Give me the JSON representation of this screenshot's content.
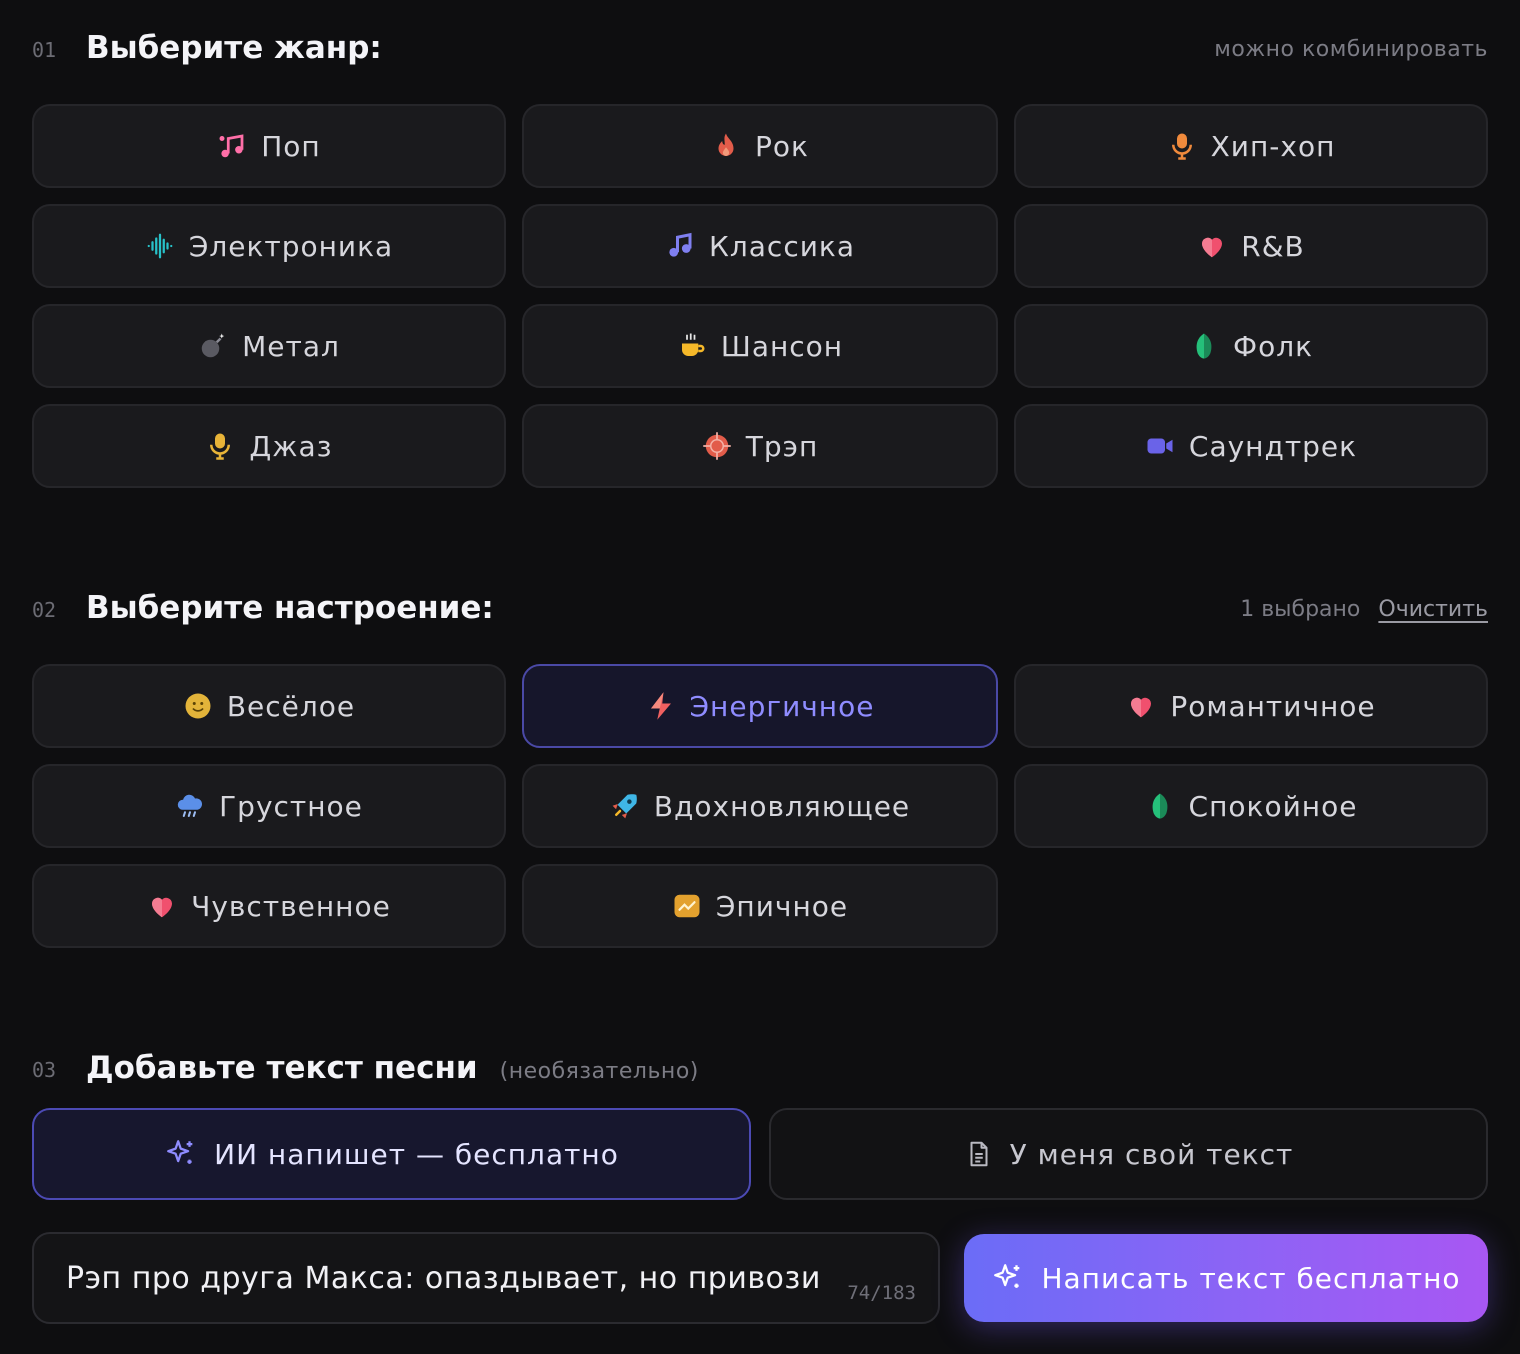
{
  "genre": {
    "num": "01",
    "title": "Выберите жанр:",
    "hint": "можно комбинировать",
    "options": [
      {
        "label": "Поп",
        "icon": "music-notes-icon",
        "color": "#ff6fa8"
      },
      {
        "label": "Рок",
        "icon": "flame-icon",
        "color": "#e25c4a"
      },
      {
        "label": "Хип-хоп",
        "icon": "microphone-icon",
        "color": "#f08a3c"
      },
      {
        "label": "Электроника",
        "icon": "sound-wave-icon",
        "color": "#28c2c9"
      },
      {
        "label": "Классика",
        "icon": "music-note-icon",
        "color": "#7f7ff0"
      },
      {
        "label": "R&B",
        "icon": "heart-icon",
        "color": "#f0506e"
      },
      {
        "label": "Метал",
        "icon": "bomb-icon",
        "color": "#8a8a94"
      },
      {
        "label": "Шансон",
        "icon": "coffee-cup-icon",
        "color": "#f5b829"
      },
      {
        "label": "Фолк",
        "icon": "leaf-icon",
        "color": "#25c07a"
      },
      {
        "label": "Джаз",
        "icon": "microphone-icon",
        "color": "#e8b438"
      },
      {
        "label": "Трэп",
        "icon": "crosshair-icon",
        "color": "#e25c4a"
      },
      {
        "label": "Саундтрек",
        "icon": "video-camera-icon",
        "color": "#6a63e8"
      }
    ]
  },
  "mood": {
    "num": "02",
    "title": "Выберите настроение:",
    "selected_count": "1 выбрано",
    "clear_label": "Очистить",
    "options": [
      {
        "label": "Весёлое",
        "icon": "smiley-icon",
        "color": "#e3b43a",
        "selected": false
      },
      {
        "label": "Энергичное",
        "icon": "lightning-icon",
        "color": "#f06060",
        "selected": true
      },
      {
        "label": "Романтичное",
        "icon": "heart-icon",
        "color": "#f0506e",
        "selected": false
      },
      {
        "label": "Грустное",
        "icon": "rain-cloud-icon",
        "color": "#5b8fe8",
        "selected": false
      },
      {
        "label": "Вдохновляющее",
        "icon": "rocket-icon",
        "color": "#3fb6e6",
        "selected": false
      },
      {
        "label": "Спокойное",
        "icon": "leaf-icon",
        "color": "#25c07a",
        "selected": false
      },
      {
        "label": "Чувственное",
        "icon": "heart-icon",
        "color": "#f0506e",
        "selected": false
      },
      {
        "label": "Эпичное",
        "icon": "trend-chart-icon",
        "color": "#e3a12e",
        "selected": false
      }
    ]
  },
  "lyrics": {
    "num": "03",
    "title": "Добавьте текст песни",
    "optional": "(необязательно)",
    "mode_ai": "ИИ напишет — бесплатно",
    "mode_own": "У меня свой текст",
    "prompt_value": "Рэп про друга Макса: опаздывает, но привози",
    "counter": "74/183",
    "cta": "Написать текст бесплатно"
  },
  "colors": {
    "accent": "#8f8cff",
    "cta_start": "#6b6cf7",
    "cta_end": "#a857f3"
  }
}
